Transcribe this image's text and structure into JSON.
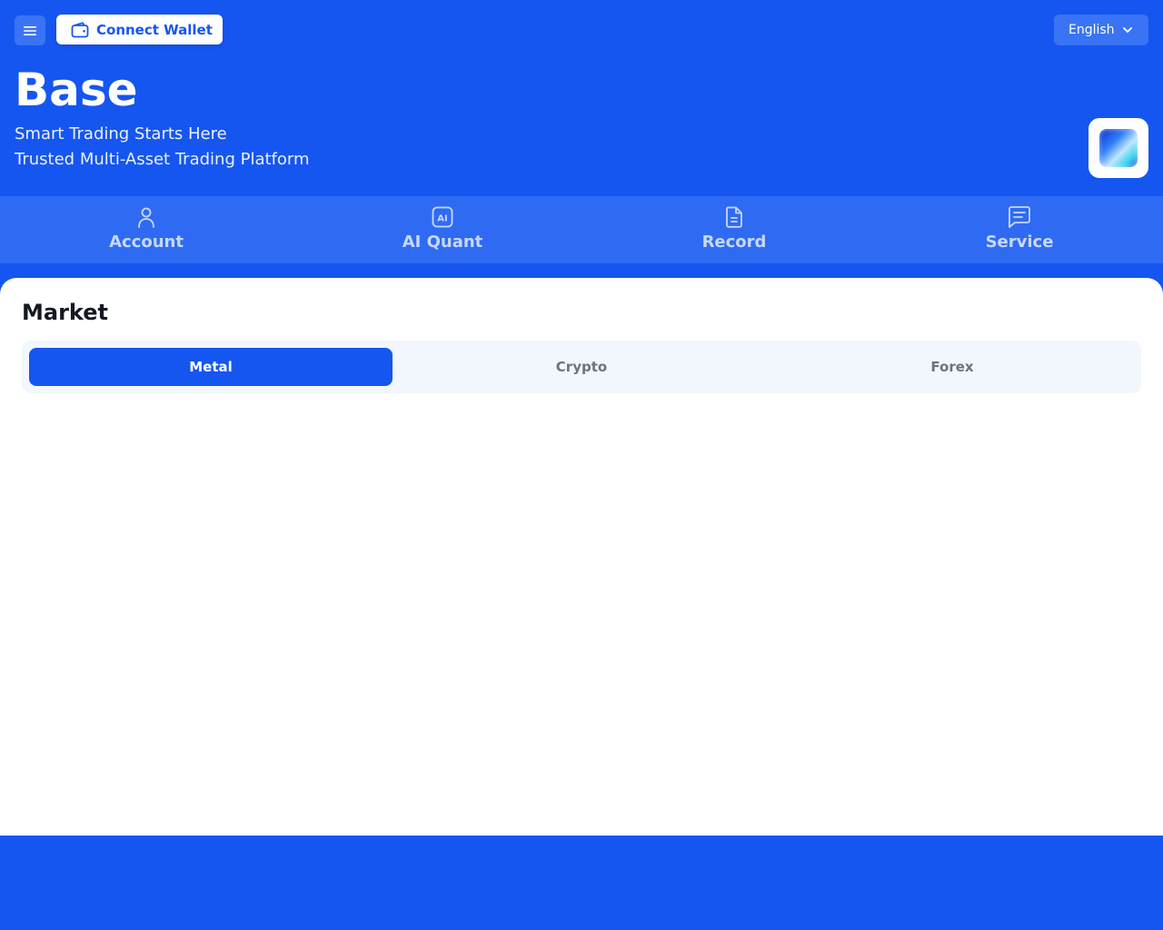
{
  "header": {
    "connect_label": "Connect Wallet",
    "language": "English",
    "title": "Base",
    "tagline_1": "Smart Trading Starts Here",
    "tagline_2": "Trusted Multi-Asset Trading Platform"
  },
  "nav": [
    {
      "label": "Account",
      "icon": "user-icon"
    },
    {
      "label": "AI Quant",
      "icon": "ai-icon"
    },
    {
      "label": "Record",
      "icon": "document-icon"
    },
    {
      "label": "Service",
      "icon": "chat-icon"
    }
  ],
  "market": {
    "title": "Market",
    "tabs": [
      {
        "label": "Metal",
        "active": true
      },
      {
        "label": "Crypto",
        "active": false
      },
      {
        "label": "Forex",
        "active": false
      }
    ]
  },
  "colors": {
    "primary": "#1656f0",
    "nav_bg": "#2f6bf2",
    "tab_bg": "#f2f7fd",
    "tab_inactive_text": "#6b7380"
  }
}
